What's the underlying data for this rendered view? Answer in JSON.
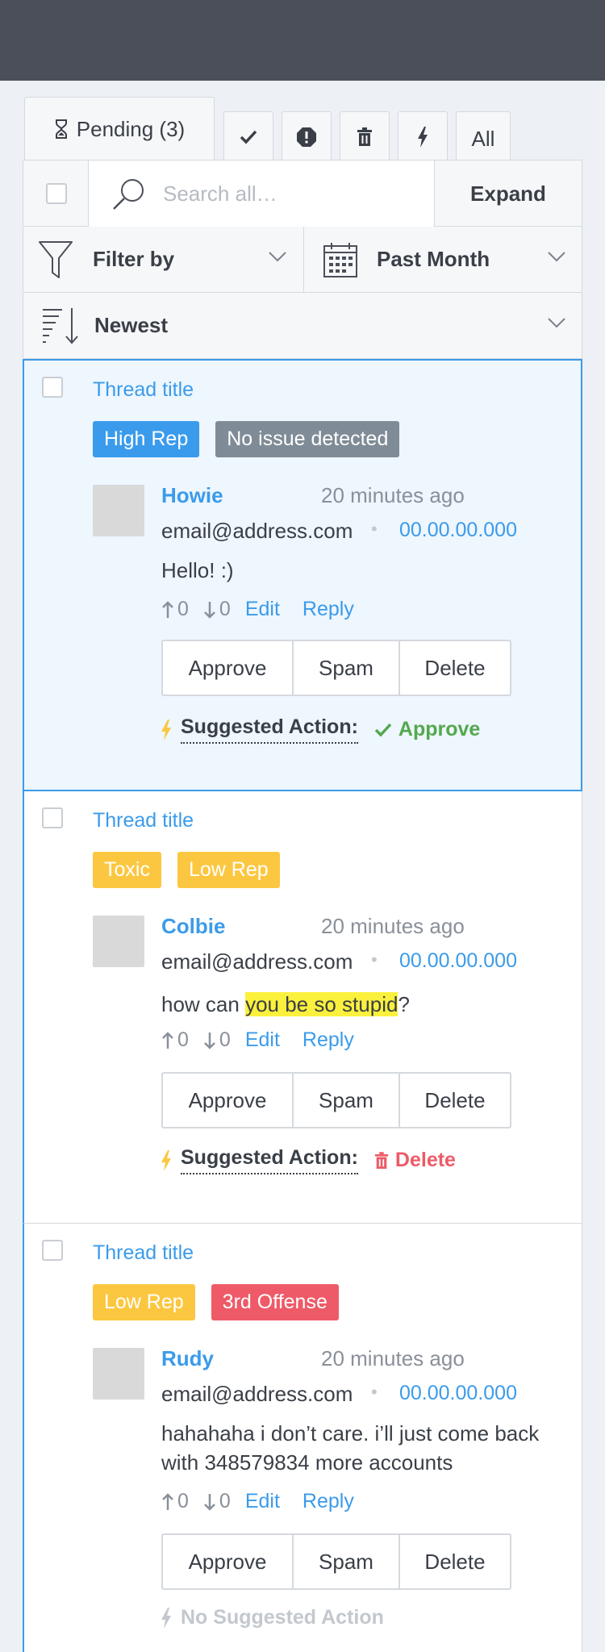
{
  "tabs": {
    "pending_label": "Pending (3)",
    "all_label": "All"
  },
  "toolbar": {
    "search_placeholder": "Search all…",
    "expand_label": "Expand",
    "filter_label": "Filter by",
    "date_label": "Past Month",
    "sort_label": "Newest"
  },
  "comments": [
    {
      "thread_title": "Thread title",
      "badges": [
        "High Rep",
        "No issue detected"
      ],
      "author": "Howie",
      "time": "20 minutes ago",
      "email": "email@address.com",
      "ip": "00.00.00.000",
      "message": "Hello! :)",
      "upvotes": "0",
      "downvotes": "0",
      "edit": "Edit",
      "reply": "Reply",
      "approve": "Approve",
      "spam": "Spam",
      "delete": "Delete",
      "suggest_label": "Suggested Action:",
      "suggest_value": "Approve"
    },
    {
      "thread_title": "Thread title",
      "badges": [
        "Toxic",
        "Low Rep"
      ],
      "author": "Colbie",
      "time": "20 minutes ago",
      "email": "email@address.com",
      "ip": "00.00.00.000",
      "message_pre": "how can ",
      "message_hl": "you be so stupid",
      "message_post": "?",
      "upvotes": "0",
      "downvotes": "0",
      "edit": "Edit",
      "reply": "Reply",
      "approve": "Approve",
      "spam": "Spam",
      "delete": "Delete",
      "suggest_label": "Suggested Action:",
      "suggest_value": "Delete"
    },
    {
      "thread_title": "Thread title",
      "badges": [
        "Low Rep",
        "3rd Offense"
      ],
      "author": "Rudy",
      "time": "20 minutes ago",
      "email": "email@address.com",
      "ip": "00.00.00.000",
      "message": "hahahaha i don’t care. i’ll just come back with 348579834 more accounts",
      "upvotes": "0",
      "downvotes": "0",
      "edit": "Edit",
      "reply": "Reply",
      "approve": "Approve",
      "spam": "Spam",
      "delete": "Delete",
      "no_suggest_label": "No Suggested Action"
    }
  ],
  "colors": {
    "topbar": "#4a4f59",
    "accent_blue": "#3b9bea",
    "badge_gray": "#7f8b96",
    "badge_yellow": "#fcc740",
    "badge_red": "#ee5a68",
    "approve_green": "#53a84e",
    "highlight": "#fbf13c"
  }
}
